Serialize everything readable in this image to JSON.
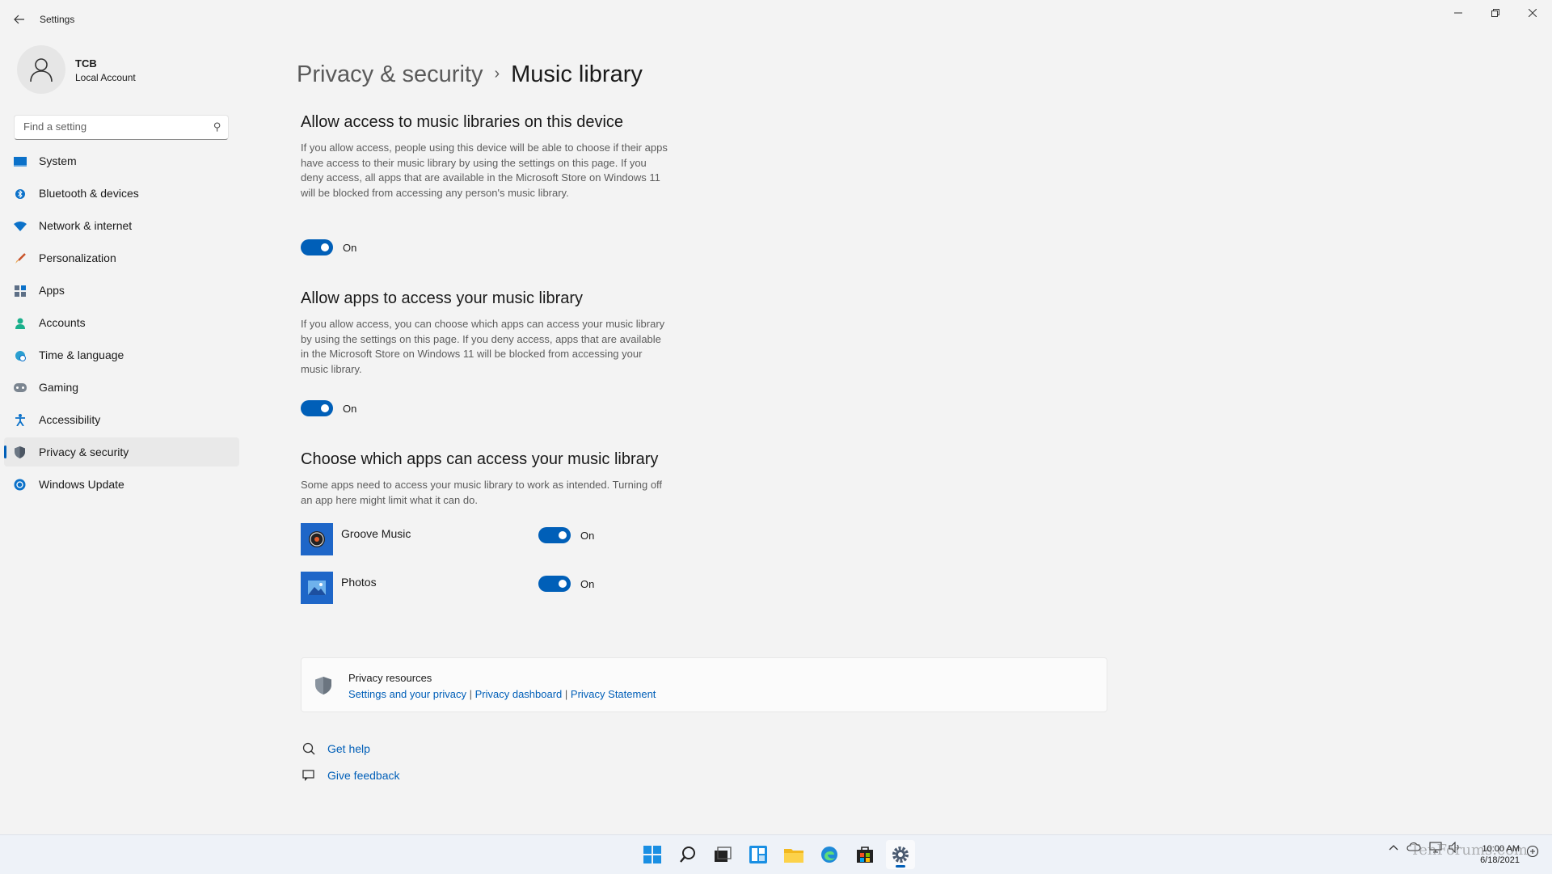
{
  "window": {
    "title": "Settings",
    "back_icon": "arrow-left-icon",
    "minimize_glyph": "–",
    "restore_glyph": "❐",
    "close_glyph": "✕"
  },
  "profile": {
    "name": "TCB",
    "account_type": "Local Account"
  },
  "search": {
    "placeholder": "Find a setting"
  },
  "sidebar": {
    "items": [
      {
        "label": "System",
        "icon": "monitor-icon"
      },
      {
        "label": "Bluetooth & devices",
        "icon": "bluetooth-icon"
      },
      {
        "label": "Network & internet",
        "icon": "wifi-icon"
      },
      {
        "label": "Personalization",
        "icon": "brush-icon"
      },
      {
        "label": "Apps",
        "icon": "apps-icon"
      },
      {
        "label": "Accounts",
        "icon": "person-icon"
      },
      {
        "label": "Time & language",
        "icon": "globe-clock-icon"
      },
      {
        "label": "Gaming",
        "icon": "gamepad-icon"
      },
      {
        "label": "Accessibility",
        "icon": "accessibility-icon"
      },
      {
        "label": "Privacy & security",
        "icon": "shield-icon",
        "active": true
      },
      {
        "label": "Windows Update",
        "icon": "update-icon"
      }
    ]
  },
  "breadcrumb": {
    "parent": "Privacy & security",
    "separator": "›",
    "current": "Music library"
  },
  "sections": {
    "device_access": {
      "title": "Allow access to music libraries on this device",
      "description": "If you allow access, people using this device will be able to choose if their apps have access to their music library by using the settings on this page. If you deny access, all apps that are available in the Microsoft Store on Windows 11 will be blocked from accessing any person's music library.",
      "toggle_state": "On"
    },
    "app_access": {
      "title": "Allow apps to access your music library",
      "description": "If you allow access, you can choose which apps can access your music library by using the settings on this page. If you deny access, apps that are available in the Microsoft Store on Windows 11 will be blocked from accessing your music library.",
      "toggle_state": "On"
    },
    "choose_apps": {
      "title": "Choose which apps can access your music library",
      "description": "Some apps need to access your music library to work as intended. Turning off an app here might limit what it can do.",
      "apps": [
        {
          "name": "Groove Music",
          "state": "On",
          "icon": "groove-music-icon"
        },
        {
          "name": "Photos",
          "state": "On",
          "icon": "photos-icon"
        }
      ]
    }
  },
  "resources": {
    "title": "Privacy resources",
    "links": [
      "Settings and your privacy",
      "Privacy dashboard",
      "Privacy Statement"
    ],
    "separator": "|"
  },
  "help": {
    "get_help": "Get help",
    "give_feedback": "Give feedback"
  },
  "taskbar": {
    "time": "10:00 AM",
    "date": "6/18/2021",
    "watermark": "TenForums.com",
    "accent": "#005fb8"
  }
}
